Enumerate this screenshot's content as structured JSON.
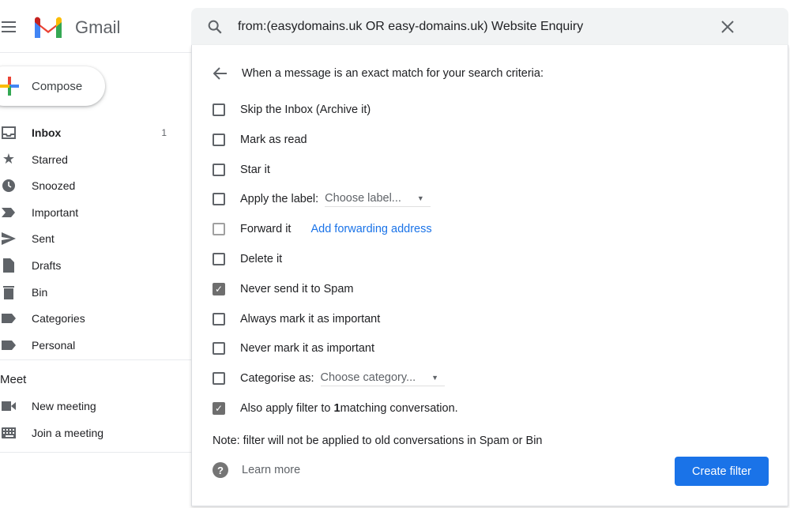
{
  "header": {
    "brand": "Gmail"
  },
  "compose": {
    "label": "Compose"
  },
  "sidebar": {
    "items": [
      {
        "label": "Inbox",
        "count": "1",
        "icon": "inbox-icon"
      },
      {
        "label": "Starred",
        "icon": "star-icon"
      },
      {
        "label": "Snoozed",
        "icon": "clock-icon"
      },
      {
        "label": "Important",
        "icon": "important-icon"
      },
      {
        "label": "Sent",
        "icon": "send-icon"
      },
      {
        "label": "Drafts",
        "icon": "draft-icon"
      },
      {
        "label": "Bin",
        "icon": "trash-icon"
      },
      {
        "label": "Categories",
        "icon": "label-icon"
      },
      {
        "label": "Personal",
        "icon": "label-icon"
      }
    ],
    "meet": {
      "title": "Meet",
      "items": [
        {
          "label": "New meeting",
          "icon": "video-icon"
        },
        {
          "label": "Join a meeting",
          "icon": "keyboard-icon"
        }
      ]
    }
  },
  "search": {
    "query": "from:(easydomains.uk OR easy-domains.uk) Website Enquiry"
  },
  "filter": {
    "heading": "When a message is an exact match for your search criteria:",
    "options": [
      {
        "label": "Skip the Inbox (Archive it)",
        "checked": false
      },
      {
        "label": "Mark as read",
        "checked": false
      },
      {
        "label": "Star it",
        "checked": false
      },
      {
        "label": "Apply the label:",
        "checked": false,
        "select": "Choose label..."
      },
      {
        "label": "Forward it",
        "checked": false,
        "link": "Add forwarding address"
      },
      {
        "label": "Delete it",
        "checked": false
      },
      {
        "label": "Never send it to Spam",
        "checked": true
      },
      {
        "label": "Always mark it as important",
        "checked": false
      },
      {
        "label": "Never mark it as important",
        "checked": false
      },
      {
        "label": "Categorise as:",
        "checked": false,
        "select": "Choose category..."
      },
      {
        "label": "Also apply filter to ",
        "bold": "1",
        "suffix": " matching conversation.",
        "checked": true
      }
    ],
    "note": "Note: filter will not be applied to old conversations in Spam or Bin",
    "learn_more": "Learn more",
    "create": "Create filter"
  },
  "colors": {
    "accent": "#1a73e8",
    "search_bg": "#f1f3f4"
  }
}
